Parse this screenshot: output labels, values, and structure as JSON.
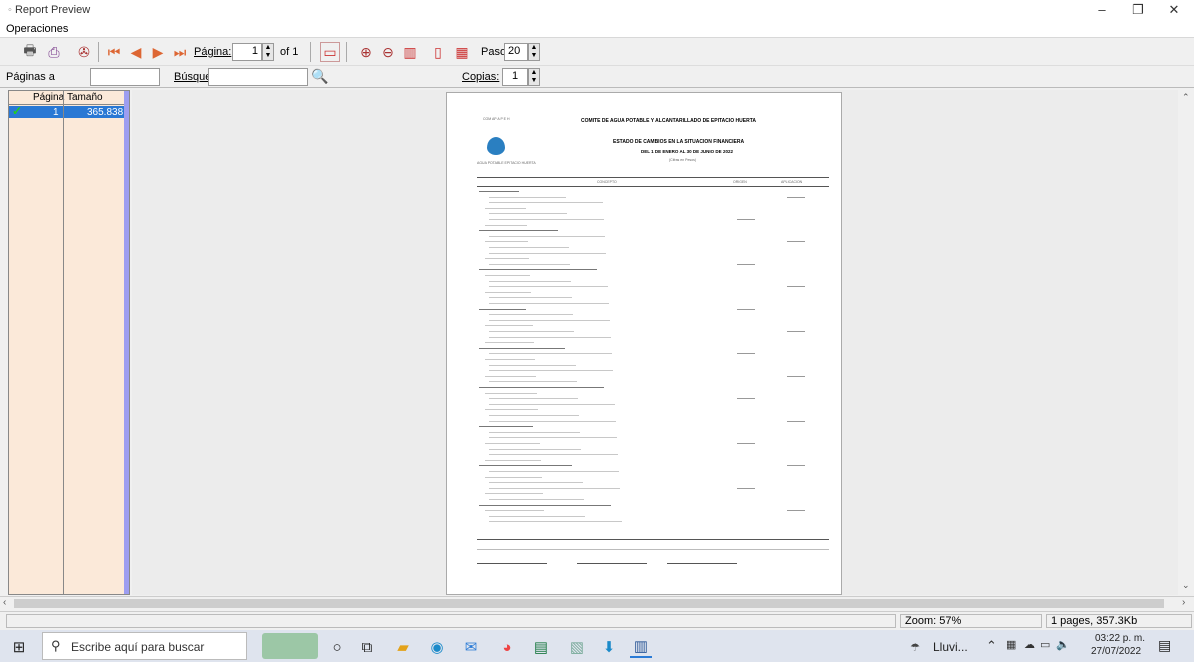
{
  "window": {
    "title": "Report Preview",
    "controls": {
      "minimize": "–",
      "maximize": "❐",
      "close": "✕"
    }
  },
  "menu": {
    "operaciones": "Operaciones"
  },
  "toolbar": {
    "pagina_label": "Página:",
    "pagina_value": "1",
    "of_label": "of 1",
    "paso_label": "Paso:",
    "paso_value": "20"
  },
  "toolbar2": {
    "paginas_label": "Páginas a",
    "paginas_value": "",
    "busqueda_label": "Búsqued",
    "busqueda_value": "",
    "copias_label": "Copias:",
    "copias_value": "1"
  },
  "pages_list": {
    "headers": [
      "Página",
      "Tamaño"
    ],
    "rows": [
      {
        "page": "1",
        "size": "365.838"
      }
    ]
  },
  "report": {
    "org_short": "COM AP A P E H",
    "title": "COMITE DE AGUA POTABLE Y ALCANTARILLADO DE EPITACIO HUERTA",
    "subtitle": "ESTADO DE CAMBIOS EN LA SITUACION FINANCIERA",
    "period": "DEL 1 DE ENERO AL 30 DE JUNIO DE 2022",
    "currency": "(Cifras en Pesos)",
    "logo_caption": "AGUA POTABLE EPITACIO HUERTA",
    "col_headers": [
      "CONCEPTO",
      "ORIGEN",
      "APLICACION"
    ]
  },
  "statusbar": {
    "zoom": "Zoom: 57%",
    "info": "1 pages, 357.3Kb"
  },
  "taskbar": {
    "search_placeholder": "Escribe aquí para buscar",
    "weather": "Lluvi...",
    "time": "03:22 p. m.",
    "date": "27/07/2022"
  },
  "colors": {
    "selection": "#2a78d4",
    "panel_bg": "#fbe9d9",
    "panel_strip": "#9d9df0"
  }
}
